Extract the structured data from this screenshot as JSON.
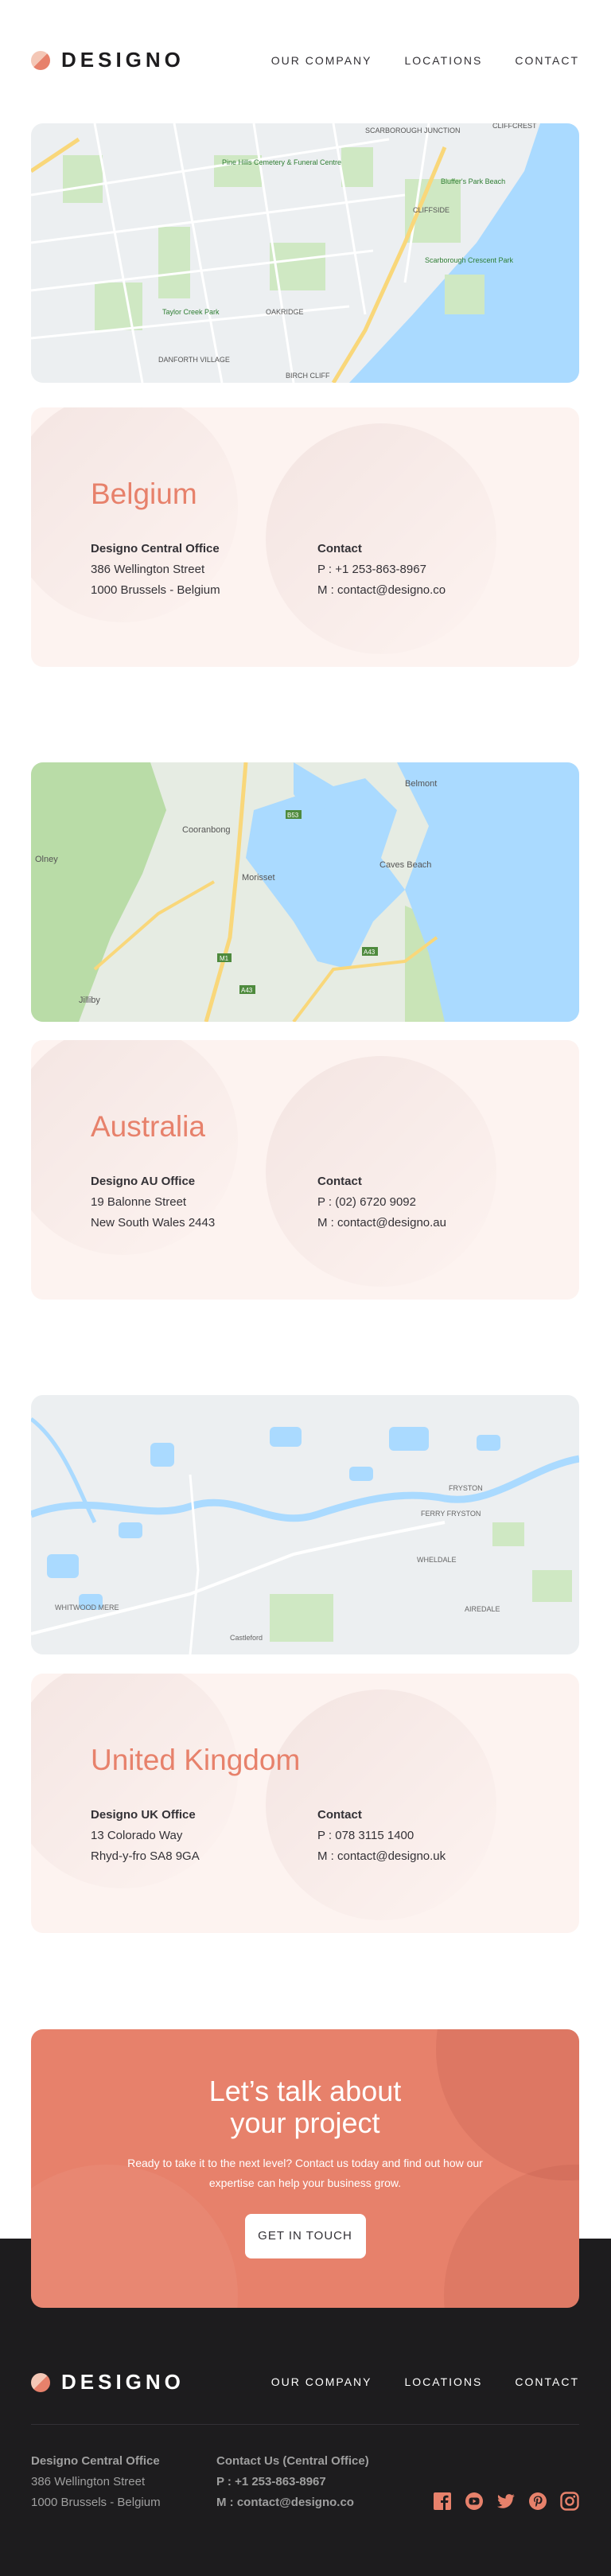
{
  "brand": {
    "name": "DESIGNO",
    "accent": "#e7816b",
    "peach": "#fdf3f0",
    "dark": "#1d1c1e"
  },
  "nav": {
    "our_company": "OUR COMPANY",
    "locations": "LOCATIONS",
    "contact": "CONTACT"
  },
  "locations": [
    {
      "country": "Belgium",
      "office_title": "Designo Central Office",
      "address_line1": "386 Wellington Street",
      "address_line2": "1000 Brussels - Belgium",
      "contact_title": "Contact",
      "phone": "P : +1 253-863-8967",
      "mail": "M : contact@designo.co",
      "map_labels": [
        "SCARBOROUGH JUNCTION",
        "CLIFFCREST",
        "Pine Hills Cemetery & Funeral Centre",
        "Bluffer's Park Beach",
        "CLIFFSIDE",
        "Scarborough Crescent Park",
        "Taylor Creek Park",
        "OAKRIDGE",
        "DANFORTH VILLAGE",
        "BIRCH CLIFF"
      ]
    },
    {
      "country": "Australia",
      "office_title": "Designo AU Office",
      "address_line1": "19 Balonne Street",
      "address_line2": "New South Wales 2443",
      "contact_title": "Contact",
      "phone": "P : (02) 6720 9092",
      "mail": "M : contact@designo.au",
      "map_labels": [
        "Belmont",
        "Cooranbong",
        "Morisset",
        "Caves Beach",
        "Olney",
        "Jilliby",
        "M1",
        "A43",
        "A43",
        "B53"
      ]
    },
    {
      "country": "United Kingdom",
      "office_title": "Designo UK Office",
      "address_line1": "13  Colorado Way",
      "address_line2": "Rhyd-y-fro SA8 9GA",
      "contact_title": "Contact",
      "phone": "P : 078 3115 1400",
      "mail": "M : contact@designo.uk",
      "map_labels": [
        "FERRY FRYSTON",
        "FRYSTON",
        "WHELDALE",
        "AIREDALE",
        "WHITWOOD MERE",
        "Castleford"
      ]
    }
  ],
  "cta": {
    "title_line1": "Let’s talk about",
    "title_line2": "your project",
    "text": "Ready to take it to the next level? Contact us today and find out how our expertise can help your business grow.",
    "button": "GET IN TOUCH"
  },
  "footer": {
    "office_title": "Designo Central Office",
    "address_line1": "386 Wellington Street",
    "address_line2": "1000 Brussels - Belgium",
    "contact_title": "Contact Us (Central Office)",
    "phone": "P : +1 253-863-8967",
    "mail": "M : contact@designo.co",
    "socials": [
      "facebook-icon",
      "youtube-icon",
      "twitter-icon",
      "pinterest-icon",
      "instagram-icon"
    ]
  }
}
